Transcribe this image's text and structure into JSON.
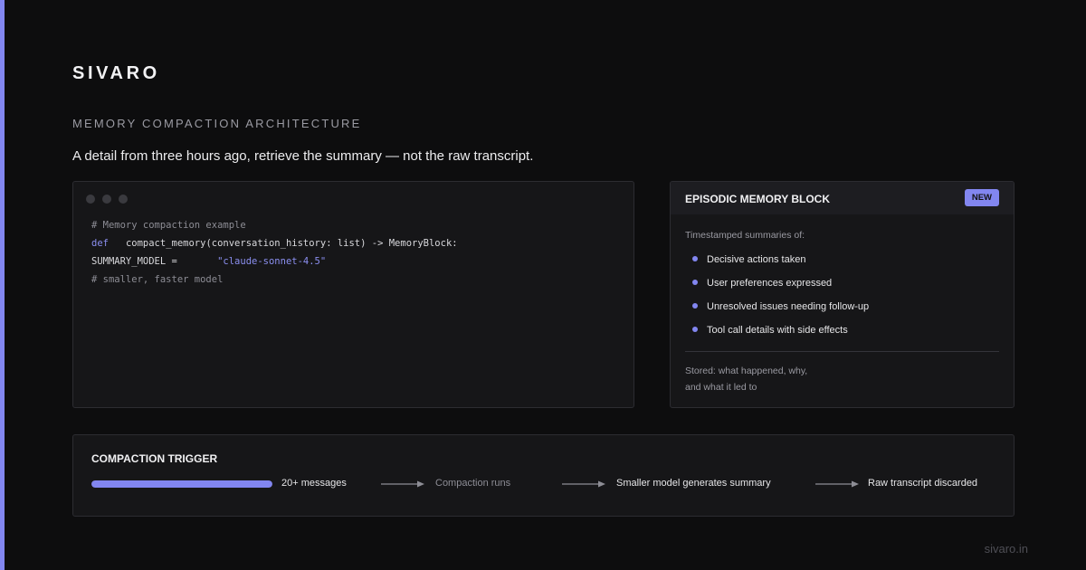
{
  "brand": "SIVARO",
  "subtitle": "MEMORY COMPACTION ARCHITECTURE",
  "headline": "A detail from three hours ago, retrieve the summary — not the raw transcript.",
  "colors": {
    "accent": "#8286f0",
    "background": "#0d0d0e",
    "panel": "#161618"
  },
  "code": {
    "line1": "# Memory compaction example",
    "line2_keyword": "def",
    "line2_rest": "compact_memory(conversation_history: list) -> MemoryBlock:",
    "line3_var": "SUMMARY_MODEL =",
    "line3_value": "\"claude-sonnet-4.5\"",
    "line4": "# smaller, faster model"
  },
  "memory_block": {
    "title": "EPISODIC MEMORY BLOCK",
    "badge": "NEW",
    "intro": "Timestamped summaries of:",
    "items": [
      "Decisive actions taken",
      "User preferences expressed",
      "Unresolved issues needing follow-up",
      "Tool call details with side effects"
    ],
    "footer_line1": "Stored: what happened, why,",
    "footer_line2": "and what it led to"
  },
  "trigger": {
    "title": "COMPACTION TRIGGER",
    "progress": 1.0,
    "steps": [
      "20+ messages",
      "Compaction runs",
      "Smaller model generates summary",
      "Raw transcript discarded"
    ]
  },
  "site": "sivaro.in"
}
